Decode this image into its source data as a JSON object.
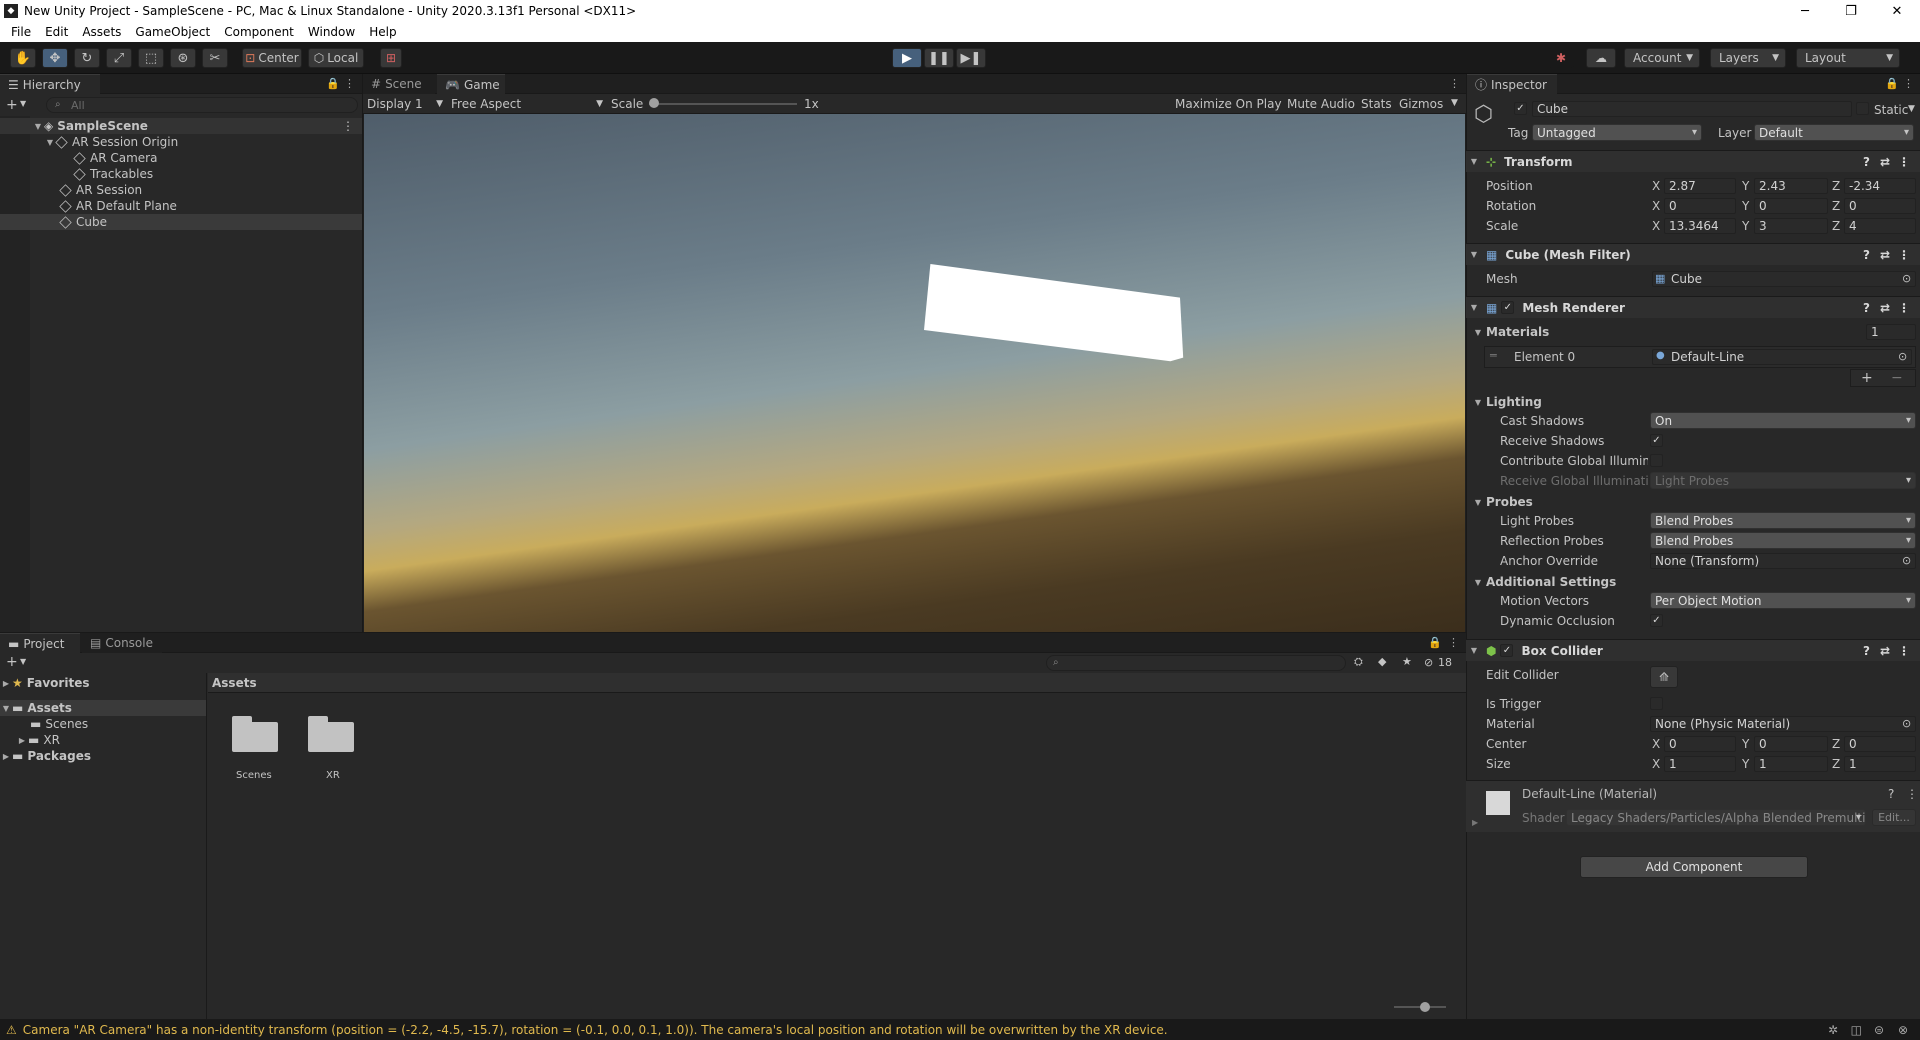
{
  "window": {
    "app_icon": "unity-logo-icon",
    "title": "New Unity Project - SampleScene - PC, Mac & Linux Standalone - Unity 2020.3.13f1 Personal <DX11>",
    "minimize": "─",
    "maximize": "❐",
    "close": "✕"
  },
  "menu": [
    "File",
    "Edit",
    "Assets",
    "GameObject",
    "Component",
    "Window",
    "Help"
  ],
  "toolbar": {
    "pivot_center": "Center",
    "pivot_local": "Local",
    "account": "Account",
    "layers": "Layers",
    "layout": "Layout"
  },
  "hierarchy": {
    "tab": "Hierarchy",
    "search_placeholder": "All",
    "add": "+",
    "items": [
      {
        "label": "SampleScene"
      },
      {
        "label": "AR Session Origin"
      },
      {
        "label": "AR Camera"
      },
      {
        "label": "Trackables"
      },
      {
        "label": "AR Session"
      },
      {
        "label": "AR Default Plane"
      },
      {
        "label": "Cube"
      }
    ]
  },
  "scene_tabs": {
    "scene": "Scene",
    "game": "Game",
    "display": "Display 1",
    "aspect": "Free Aspect",
    "scale_label": "Scale",
    "scale_value": "1x",
    "maximize": "Maximize On Play",
    "mute": "Mute Audio",
    "stats": "Stats",
    "gizmos": "Gizmos"
  },
  "project": {
    "tab_project": "Project",
    "tab_console": "Console",
    "favorites": "Favorites",
    "assets": "Assets",
    "scenes": "Scenes",
    "xr": "XR",
    "packages": "Packages",
    "breadcrumb": "Assets",
    "hidden_count": "18",
    "grid_items": [
      "Scenes",
      "XR"
    ]
  },
  "inspector": {
    "tab": "Inspector",
    "object_name": "Cube",
    "static": "Static",
    "tag_label": "Tag",
    "tag_value": "Untagged",
    "layer_label": "Layer",
    "layer_value": "Default",
    "transform": {
      "title": "Transform",
      "position_label": "Position",
      "rotation_label": "Rotation",
      "scale_label": "Scale",
      "position": {
        "x": "2.87",
        "y": "2.43",
        "z": "-2.34"
      },
      "rotation": {
        "x": "0",
        "y": "0",
        "z": "0"
      },
      "scale": {
        "x": "13.3464",
        "y": "3",
        "z": "4"
      }
    },
    "mesh_filter": {
      "title": "Cube (Mesh Filter)",
      "mesh_label": "Mesh",
      "mesh_value": "Cube"
    },
    "mesh_renderer": {
      "title": "Mesh Renderer",
      "materials": "Materials",
      "materials_count": "1",
      "element0_label": "Element 0",
      "element0_value": "Default-Line",
      "lighting": "Lighting",
      "cast_shadows_label": "Cast Shadows",
      "cast_shadows_value": "On",
      "receive_shadows_label": "Receive Shadows",
      "contribute_gi_label": "Contribute Global Illuminat",
      "receive_gi_label": "Receive Global Illuminatior",
      "receive_gi_value": "Light Probes",
      "probes": "Probes",
      "light_probes_label": "Light Probes",
      "light_probes_value": "Blend Probes",
      "reflection_probes_label": "Reflection Probes",
      "reflection_probes_value": "Blend Probes",
      "anchor_label": "Anchor Override",
      "anchor_value": "None (Transform)",
      "additional": "Additional Settings",
      "motion_label": "Motion Vectors",
      "motion_value": "Per Object Motion",
      "dynamic_label": "Dynamic Occlusion"
    },
    "box_collider": {
      "title": "Box Collider",
      "edit_label": "Edit Collider",
      "trigger_label": "Is Trigger",
      "material_label": "Material",
      "material_value": "None (Physic Material)",
      "center_label": "Center",
      "size_label": "Size",
      "center": {
        "x": "0",
        "y": "0",
        "z": "0"
      },
      "size": {
        "x": "1",
        "y": "1",
        "z": "1"
      }
    },
    "material": {
      "title": "Default-Line (Material)",
      "shader_label": "Shader",
      "shader_value": "Legacy Shaders/Particles/Alpha Blended Premulti",
      "edit": "Edit..."
    },
    "add_component": "Add Component"
  },
  "status": {
    "message": "Camera \"AR Camera\" has a non-identity transform (position = (-2.2, -4.5, -15.7), rotation = (-0.1, 0.0, 0.1, 1.0)). The camera's local position and rotation will be overwritten by the XR device."
  },
  "colors": {
    "accent": "#46607c",
    "warning": "#e0b94e"
  }
}
